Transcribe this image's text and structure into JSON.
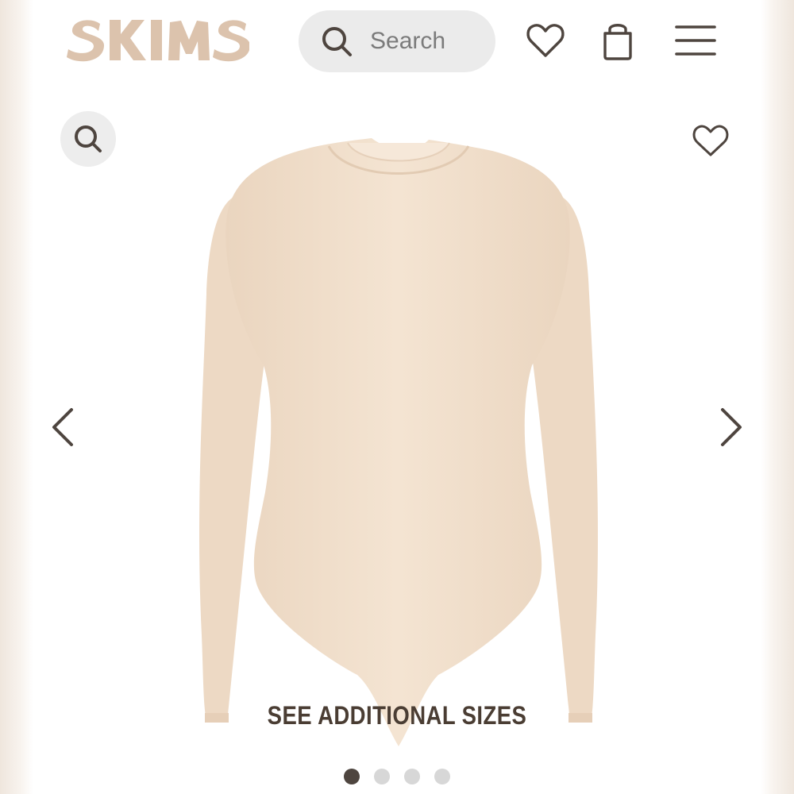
{
  "header": {
    "logo_text": "SKIMS",
    "search": {
      "placeholder": "Search",
      "icon": "search-icon"
    },
    "icons": [
      "heart-icon",
      "shopping-bag-icon",
      "hamburger-menu-icon"
    ]
  },
  "gallery": {
    "zoom_icon": "magnifier-icon",
    "favorite_icon": "heart-icon",
    "prev_icon": "chevron-left-icon",
    "next_icon": "chevron-right-icon",
    "cta_label": "SEE ADDITIONAL SIZES",
    "slide_count": 4,
    "active_slide": 1
  },
  "colors": {
    "logo": "#dcc3ad",
    "icon": "#4e453f",
    "product": "#f2e0cc",
    "dot_active": "#4e453f",
    "dot_inactive": "#d7d7d7"
  }
}
